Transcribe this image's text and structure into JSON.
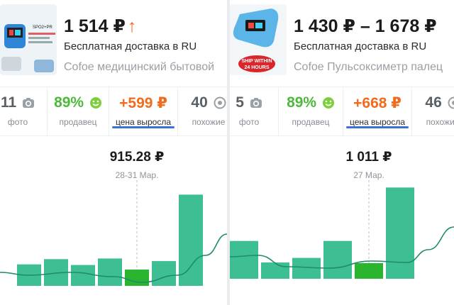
{
  "panels": [
    {
      "price": "1 514 ₽",
      "price_trend": "↑",
      "delivery": "Бесплатная доставка в RU",
      "title": "Cofoe медицинский бытовой",
      "thumb_text": [
        "SPO2+PR"
      ],
      "metrics": [
        {
          "value": "11",
          "label": "фото",
          "icon": "camera-icon"
        },
        {
          "value": "89%",
          "label": "продавец",
          "icon": "smiley-icon"
        },
        {
          "value": "+599 ₽",
          "label": "цена выросла",
          "active": true
        },
        {
          "value": "40",
          "label": "похожие",
          "icon": "target-icon"
        }
      ],
      "highlight": {
        "value": "915.28 ₽",
        "date": "28-31 Мар."
      },
      "chart_data": {
        "type": "bar",
        "values": [
          33,
          41,
          32,
          42,
          25,
          38,
          140
        ],
        "highlight_index": 4,
        "ylim": [
          0,
          160
        ]
      }
    },
    {
      "price": "1 430 ₽ – 1 678 ₽",
      "price_trend": "",
      "delivery": "Бесплатная доставка в RU",
      "title": "Cofoe Пульсоксиметр палец",
      "thumb_text": [
        "SHIP WITHIN",
        "24 HOURS"
      ],
      "metrics": [
        {
          "value": "5",
          "label": "фото",
          "icon": "camera-icon"
        },
        {
          "value": "89%",
          "label": "продавец",
          "icon": "smiley-icon"
        },
        {
          "value": "+668 ₽",
          "label": "цена выросла",
          "active": true
        },
        {
          "value": "46",
          "label": "похожие",
          "icon": "target-icon"
        }
      ],
      "highlight": {
        "value": "1 011 ₽",
        "date": "27 Мар."
      },
      "chart_data": {
        "type": "bar",
        "values": [
          58,
          25,
          32,
          58,
          24,
          140
        ],
        "highlight_index": 4,
        "ylim": [
          0,
          160
        ]
      }
    }
  ],
  "colors": {
    "bar": "#3ebf93",
    "bar_highlight": "#2bb52f",
    "curve": "#1f8a6f",
    "accent_orange": "#f26a1b",
    "seller_green": "#4cb93a",
    "tab_underline": "#3b6fd9"
  }
}
